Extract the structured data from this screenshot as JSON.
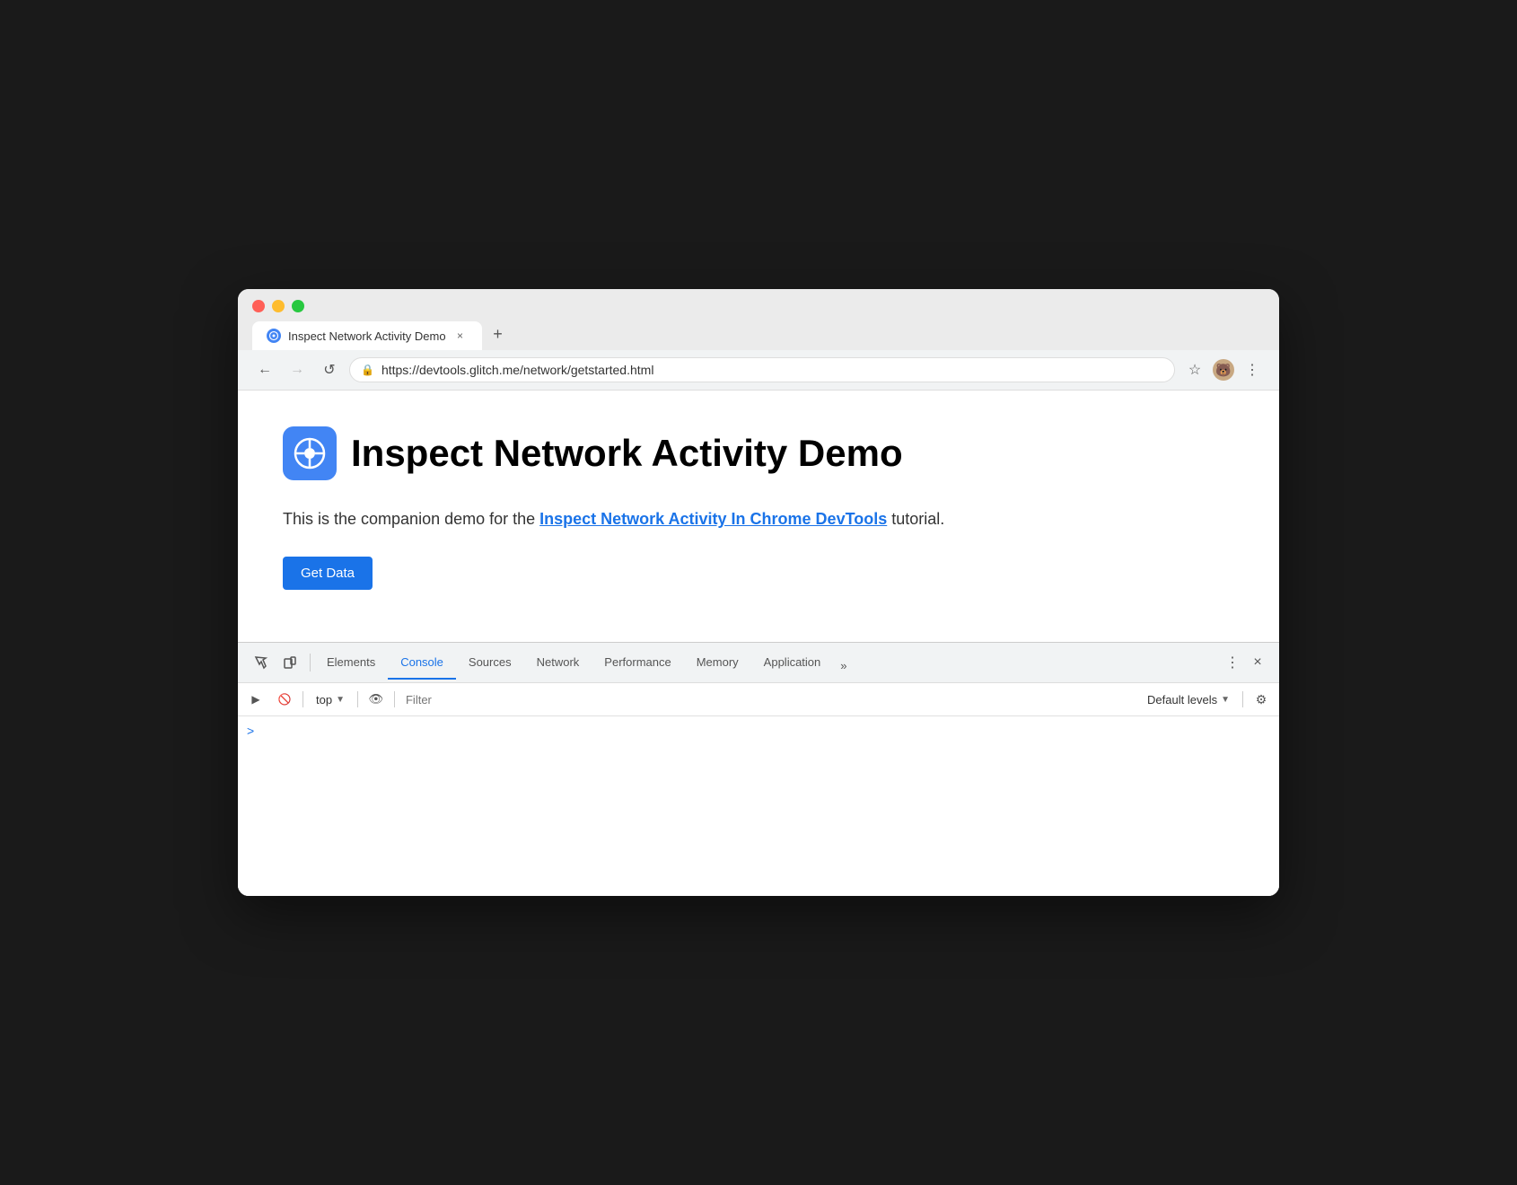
{
  "browser": {
    "tab": {
      "title": "Inspect Network Activity Demo",
      "close_label": "×",
      "favicon_emoji": "🔵"
    },
    "new_tab_label": "+",
    "nav": {
      "back_label": "←",
      "forward_label": "→",
      "reload_label": "↺",
      "url": "https://devtools.glitch.me/network/getstarted.html",
      "lock_symbol": "🔒",
      "star_symbol": "☆",
      "menu_symbol": "⋮"
    }
  },
  "page": {
    "title": "Inspect Network Activity Demo",
    "description_prefix": "This is the companion demo for the ",
    "link_text": "Inspect Network Activity In Chrome DevTools",
    "description_suffix": " tutorial.",
    "button_label": "Get Data"
  },
  "devtools": {
    "tabs": [
      {
        "label": "Elements",
        "active": false
      },
      {
        "label": "Console",
        "active": true
      },
      {
        "label": "Sources",
        "active": false
      },
      {
        "label": "Network",
        "active": false
      },
      {
        "label": "Performance",
        "active": false
      },
      {
        "label": "Memory",
        "active": false
      },
      {
        "label": "Application",
        "active": false
      }
    ],
    "more_label": "»",
    "close_label": "×",
    "menu_label": "⋮"
  },
  "console": {
    "context_label": "top",
    "filter_placeholder": "Filter",
    "filter_value": "",
    "default_levels_label": "Default levels",
    "dropdown_arrow": "▼",
    "cursor_label": ">"
  },
  "icons": {
    "play_icon": "▶",
    "block_icon": "🚫",
    "chevron_down": "▼",
    "eye_icon": "👁",
    "gear_icon": "⚙",
    "inspect_cursor": "↖",
    "device_toggle": "□",
    "vertical_dots": "⋮",
    "close": "✕"
  }
}
